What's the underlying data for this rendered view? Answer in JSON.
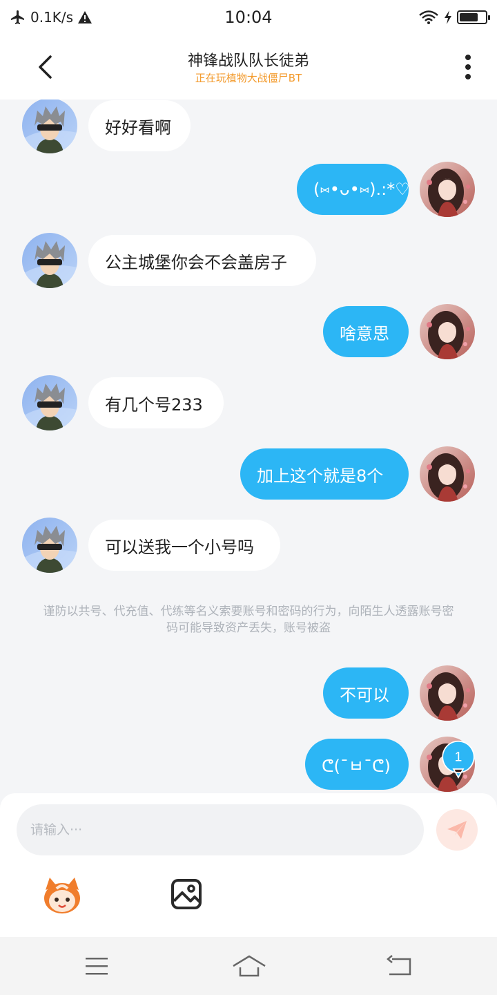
{
  "status_bar": {
    "speed": "0.1K/s",
    "time": "10:04",
    "battery_level": 0.72,
    "icons": [
      "airplane-icon",
      "warning-icon",
      "wifi-icon",
      "charging-icon",
      "battery-icon"
    ]
  },
  "header": {
    "title": "神锋战队队长徒弟",
    "subtitle": "正在玩植物大战僵尸BT"
  },
  "messages": [
    {
      "side": "in",
      "text": "好好看啊"
    },
    {
      "side": "out",
      "text": "(⑅•ᴗ•⑅).:*♡"
    },
    {
      "side": "in",
      "text": "公主城堡你会不会盖房子"
    },
    {
      "side": "out",
      "text": "啥意思"
    },
    {
      "side": "in",
      "text": "有几个号233"
    },
    {
      "side": "out",
      "text": "加上这个就是8个"
    },
    {
      "side": "in",
      "text": "可以送我一个小号吗"
    },
    {
      "side": "out",
      "text": "不可以"
    },
    {
      "side": "out",
      "text": "ᕦ(¯ㅂ¯ᕦ)"
    }
  ],
  "notice": "谨防以共号、代充值、代练等名义索要账号和密码的行为，向陌生人透露账号密码可能导致资产丢失，账号被盗",
  "unread_badge": "1",
  "composer": {
    "placeholder": "请输入···"
  },
  "colors": {
    "outgoing_bubble": "#2cb6f5",
    "incoming_bubble": "#ffffff",
    "subtitle": "#f39a2b",
    "send_button": "#fde8e2"
  }
}
